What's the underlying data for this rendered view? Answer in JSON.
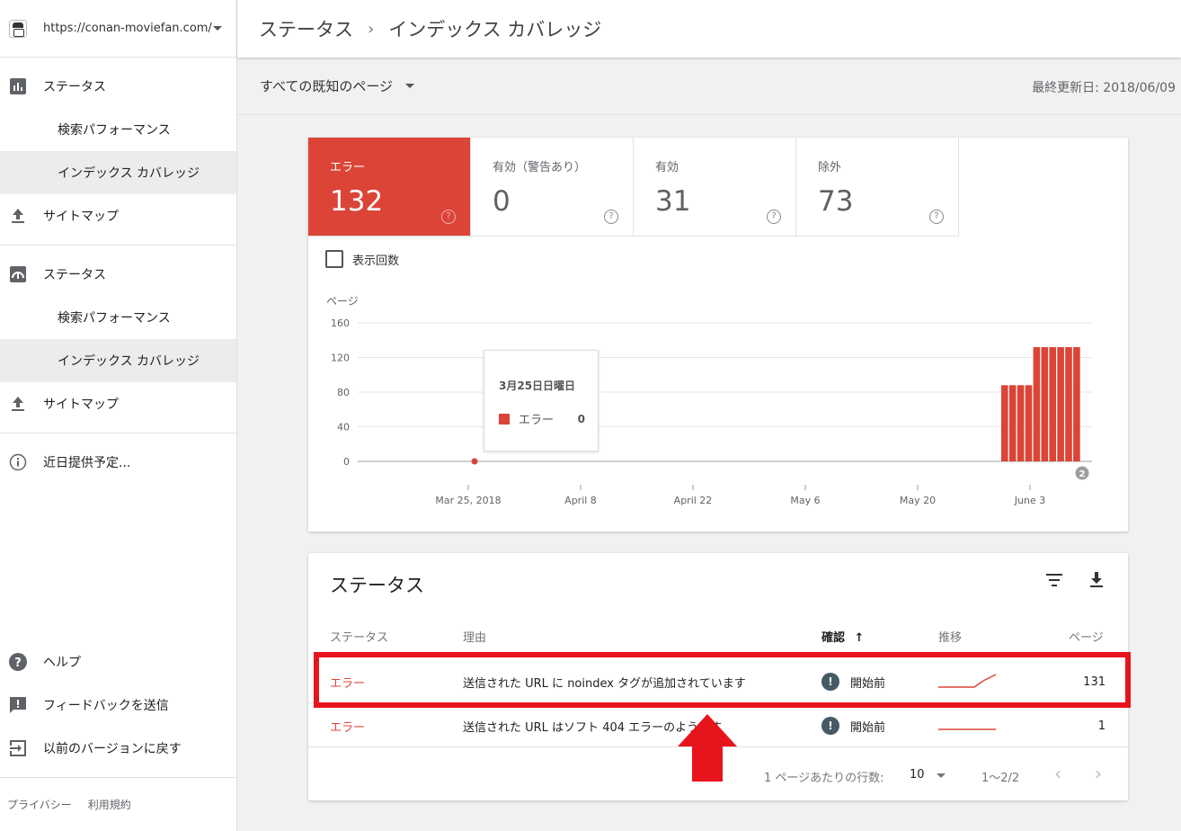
{
  "sidebar": {
    "site_url": "https://conan-moviefan.com/",
    "groups": [
      {
        "header": "ステータス",
        "items": [
          "検索パフォーマンス",
          "インデックス カバレッジ"
        ],
        "sitemap": "サイトマップ"
      },
      {
        "header": "ステータス",
        "items": [
          "検索パフォーマンス",
          "インデックス カバレッジ"
        ],
        "sitemap": "サイトマップ"
      }
    ],
    "coming_soon": "近日提供予定...",
    "help": "ヘルプ",
    "feedback": "フィードバックを送信",
    "back": "以前のバージョンに戻す",
    "privacy": "プライバシー",
    "terms": "利用規約"
  },
  "header": {
    "crumb1": "ステータス",
    "crumb2": "インデックス カバレッジ"
  },
  "filter": {
    "label": "すべての既知のページ",
    "updated": "最終更新日: 2018/06/09"
  },
  "tiles": [
    {
      "label": "エラー",
      "value": "132",
      "active": true
    },
    {
      "label": "有効（警告あり）",
      "value": "0",
      "active": false
    },
    {
      "label": "有効",
      "value": "31",
      "active": false
    },
    {
      "label": "除外",
      "value": "73",
      "active": false
    }
  ],
  "impressions_label": "表示回数",
  "chart_data": {
    "type": "bar",
    "ylabel": "ページ",
    "ylim": [
      0,
      160
    ],
    "yticks": [
      0,
      40,
      80,
      120,
      160
    ],
    "xticks": [
      "Mar 25, 2018",
      "April 8",
      "April 22",
      "May 6",
      "May 20",
      "June 3"
    ],
    "series": [
      {
        "name": "エラー",
        "color": "#db4437",
        "x": [
          "May 29",
          "May 30",
          "May 31",
          "June 1",
          "June 2",
          "June 3",
          "June 4",
          "June 5",
          "June 6",
          "June 7"
        ],
        "values": [
          88,
          88,
          88,
          88,
          132,
          132,
          132,
          132,
          132,
          132
        ]
      }
    ],
    "highlight_point": {
      "x": "Mar 25, 2018",
      "value": 0
    },
    "annotation_badge": "2",
    "tooltip": {
      "title": "3月25日日曜日",
      "label": "エラー",
      "value": "0"
    }
  },
  "table": {
    "title": "ステータス",
    "headers": {
      "status": "ステータス",
      "reason": "理由",
      "validation": "確認",
      "trend": "推移",
      "pages": "ページ"
    },
    "rows": [
      {
        "status": "エラー",
        "reason": "送信された URL に noindex タグが追加されています",
        "validation": "開始前",
        "pages": "131"
      },
      {
        "status": "エラー",
        "reason": "送信された URL はソフト 404 エラーのようです",
        "validation": "開始前",
        "pages": "1"
      }
    ],
    "rows_per_page_label": "1 ページあたりの行数:",
    "rows_per_page": "10",
    "range": "1～2/2"
  },
  "colors": {
    "error": "#db4437",
    "highlight_box": "#e8141c"
  }
}
